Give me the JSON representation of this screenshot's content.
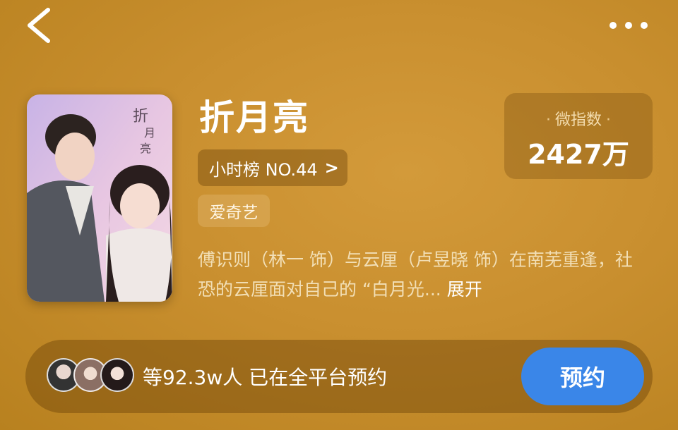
{
  "header": {
    "back_icon": "chevron-left-icon",
    "more_icon": "more-dots-icon"
  },
  "show": {
    "title": "折月亮",
    "rank_label": "小时榜 NO.44",
    "rank_chevron": ">",
    "platform": "爱奇艺",
    "description": "傅识则（林一 饰）与云厘（卢昱晓 饰）在南芜重逢，社恐的云厘面对自己的 “白月光...",
    "expand_label": "展开"
  },
  "index_card": {
    "label": "微指数",
    "value": "2427万"
  },
  "reservation": {
    "text": "等92.3w人 已在全平台预约",
    "button_label": "预约"
  },
  "colors": {
    "accent_button": "#3a86e8",
    "background": "#c98f2f"
  }
}
